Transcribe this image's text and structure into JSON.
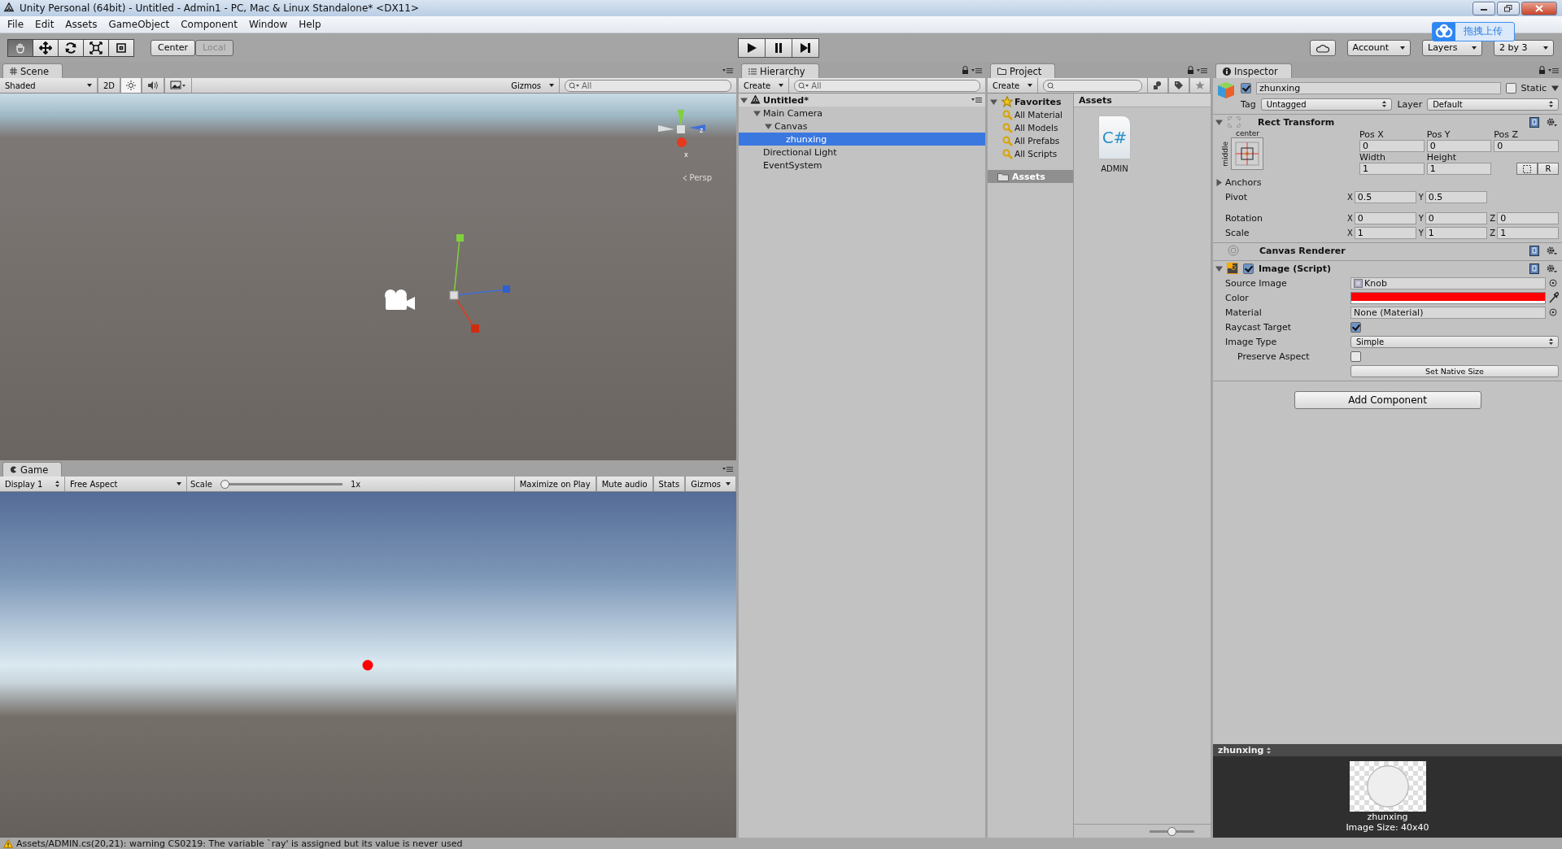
{
  "window": {
    "title": "Unity Personal (64bit) - Untitled - Admin1 - PC, Mac & Linux Standalone* <DX11>"
  },
  "menu": [
    "File",
    "Edit",
    "Assets",
    "GameObject",
    "Component",
    "Window",
    "Help"
  ],
  "toolbar": {
    "tools": [
      {
        "kind": "hand",
        "selected": true
      },
      {
        "kind": "move",
        "selected": false
      },
      {
        "kind": "rotate",
        "selected": false
      },
      {
        "kind": "scale",
        "selected": false
      },
      {
        "kind": "rect",
        "selected": false
      }
    ],
    "pivot_buttons": [
      {
        "label": "Center",
        "selected": true
      },
      {
        "label": "Local",
        "selected": false
      }
    ],
    "account": "Account",
    "layers": "Layers",
    "layout": "2 by 3",
    "upload_badge": "拖拽上传"
  },
  "scene": {
    "tab": "Scene",
    "shading": "Shaded",
    "mode": "2D",
    "lighting_on": true,
    "audio_on": false,
    "gizmos": "Gizmos",
    "search_placeholder": "All",
    "projection": "Persp",
    "axis_labels": [
      "z",
      "x"
    ]
  },
  "game": {
    "tab": "Game",
    "display": "Display 1",
    "aspect": "Free Aspect",
    "scale_label": "Scale",
    "scale": {
      "level": 0
    },
    "scale_value": "1x",
    "buttons": [
      "Maximize on Play",
      "Mute audio",
      "Stats",
      "Gizmos"
    ]
  },
  "hierarchy": {
    "tab": "Hierarchy",
    "create": "Create",
    "search_placeholder": "All",
    "scene": "Untitled*",
    "items": [
      {
        "name": "Main Camera",
        "expanded": true,
        "selected": false,
        "children": [
          {
            "name": "Canvas",
            "expanded": true,
            "selected": false,
            "children": [
              {
                "name": "zhunxing",
                "selected": true
              }
            ]
          }
        ]
      },
      {
        "name": "Directional Light",
        "selected": false
      },
      {
        "name": "EventSystem",
        "selected": false
      }
    ]
  },
  "project": {
    "tab": "Project",
    "create": "Create",
    "favorites": "Favorites",
    "favorite_items": [
      "All Material",
      "All Models",
      "All Prefabs",
      "All Scripts"
    ],
    "folders": [
      {
        "name": "Assets",
        "selected": true
      }
    ],
    "path": "Assets",
    "icon_size": {
      "level": 0.5
    },
    "files": [
      {
        "name": "ADMIN",
        "icon_text": "C#"
      }
    ]
  },
  "inspector": {
    "tab": "Inspector",
    "name": "zhunxing",
    "active": true,
    "static_label": "Static",
    "static": false,
    "tag_label": "Tag",
    "tag": "Untagged",
    "layer_label": "Layer",
    "layer": "Default",
    "rect_transform": {
      "title": "Rect Transform",
      "anchor_h": "center",
      "anchor_v": "middle",
      "pos_labels": [
        "Pos X",
        "Pos Y",
        "Pos Z"
      ],
      "pos_values": [
        "0",
        "0",
        "0"
      ],
      "size_labels": [
        "Width",
        "Height"
      ],
      "size_values": [
        "1",
        "1"
      ],
      "raw_button": "R",
      "anchors": "Anchors",
      "vectors": [
        {
          "label": "Pivot",
          "fields": [
            {
              "axis": "X",
              "value": "0.5"
            },
            {
              "axis": "Y",
              "value": "0.5"
            }
          ]
        },
        {
          "label": "Rotation",
          "fields": [
            {
              "axis": "X",
              "value": "0"
            },
            {
              "axis": "Y",
              "value": "0"
            },
            {
              "axis": "Z",
              "value": "0"
            }
          ]
        },
        {
          "label": "Scale",
          "fields": [
            {
              "axis": "X",
              "value": "1"
            },
            {
              "axis": "Y",
              "value": "1"
            },
            {
              "axis": "Z",
              "value": "1"
            }
          ]
        }
      ]
    },
    "canvas_renderer": {
      "title": "Canvas Renderer"
    },
    "image": {
      "title": "Image (Script)",
      "enabled": true,
      "rows": [
        {
          "kind": "object",
          "label": "Source Image",
          "value": "Knob"
        },
        {
          "kind": "color",
          "label": "Color",
          "color": "#ff0000"
        },
        {
          "kind": "object",
          "label": "Material",
          "value": "None (Material)"
        },
        {
          "kind": "checkbox",
          "label": "Raycast Target",
          "checked": true
        },
        {
          "kind": "dropdown",
          "label": "Image Type",
          "value": "Simple"
        },
        {
          "kind": "checkbox",
          "label": "Preserve Aspect",
          "checked": false,
          "indent": true
        },
        {
          "kind": "button",
          "value": "Set Native Size"
        }
      ]
    },
    "add_component": "Add Component",
    "preview": {
      "title": "zhunxing",
      "caption": [
        "zhunxing",
        "Image Size: 40x40"
      ]
    }
  },
  "status_bar": "Assets/ADMIN.cs(20,21): warning CS0219: The variable `ray' is assigned but its value is never used"
}
